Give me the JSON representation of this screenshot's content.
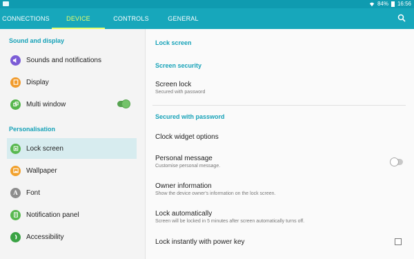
{
  "status_bar": {
    "battery": "84%",
    "time": "16:56"
  },
  "tabs": [
    {
      "label": "CONNECTIONS",
      "active": false
    },
    {
      "label": "DEVICE",
      "active": true
    },
    {
      "label": "CONTROLS",
      "active": false
    },
    {
      "label": "GENERAL",
      "active": false
    }
  ],
  "sidebar": {
    "sections": [
      {
        "title": "Sound and display"
      },
      {
        "title": "Personalisation"
      }
    ],
    "items": [
      {
        "label": "Sounds and notifications",
        "icon": "speaker-icon",
        "color": "#7b5cd6"
      },
      {
        "label": "Display",
        "icon": "display-icon",
        "color": "#f19b2c"
      },
      {
        "label": "Multi window",
        "icon": "multi-window-icon",
        "color": "#56b64d",
        "toggle": true
      },
      {
        "label": "Lock screen",
        "icon": "lock-screen-icon",
        "color": "#58b84f",
        "selected": true
      },
      {
        "label": "Wallpaper",
        "icon": "wallpaper-icon",
        "color": "#f1a12d"
      },
      {
        "label": "Font",
        "icon": "font-icon",
        "color": "#8d8d8d"
      },
      {
        "label": "Notification panel",
        "icon": "notification-panel-icon",
        "color": "#58b84f"
      },
      {
        "label": "Accessibility",
        "icon": "accessibility-icon",
        "color": "#3aa344"
      }
    ]
  },
  "content": {
    "page_header": "Lock screen",
    "screen_security_header": "Screen security",
    "screen_lock": {
      "title": "Screen lock",
      "subtitle": "Secured with password"
    },
    "secured_header": "Secured with password",
    "clock_widget": {
      "title": "Clock widget options"
    },
    "personal_message": {
      "title": "Personal message",
      "subtitle": "Customise personal message."
    },
    "owner_information": {
      "title": "Owner information",
      "subtitle": "Show the device owner's information on the lock screen."
    },
    "lock_automatically": {
      "title": "Lock automatically",
      "subtitle": "Screen will be locked in 5 minutes after screen automatically turns off."
    },
    "lock_instantly": {
      "title": "Lock instantly with power key"
    }
  },
  "colors": {
    "tab_bar": "#17a7bb",
    "status_bar": "#0f9bb0",
    "accent": "#16a2b8",
    "active_tab": "#e9ff6a"
  }
}
